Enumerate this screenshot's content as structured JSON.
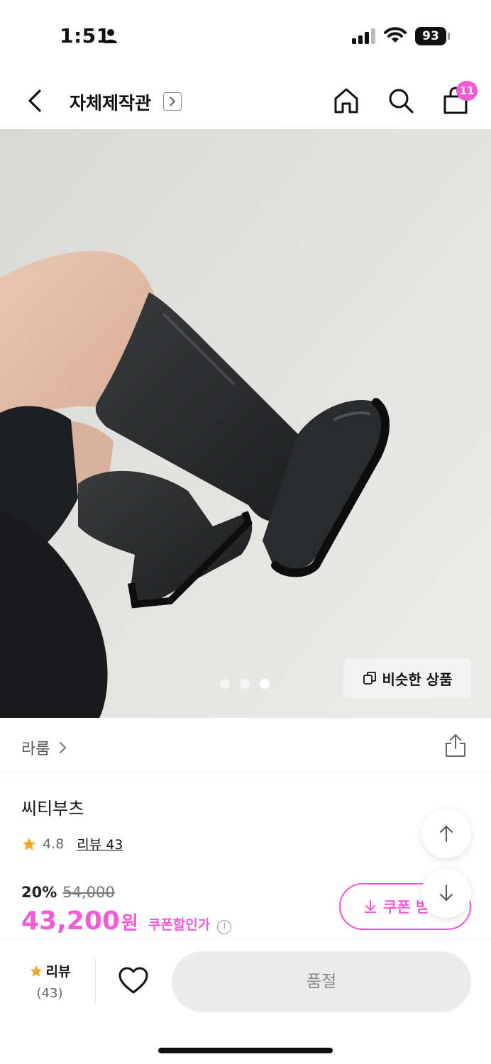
{
  "status_bar": {
    "time": "1:51",
    "battery": "93"
  },
  "header": {
    "title": "자체제작관",
    "cart_count": "11"
  },
  "hero": {
    "similar_button": "비슷한 상품",
    "slide_count": 3,
    "active_slide": 3
  },
  "brand": {
    "name": "라룸"
  },
  "product": {
    "name": "씨티부츠",
    "rating": "4.8",
    "review_label": "리뷰 43",
    "discount_percent": "20%",
    "original_price": "54,000",
    "price": "43,200",
    "currency": "원",
    "coupon_price_label": "쿠폰할인가",
    "coupon_button": "쿠폰 받"
  },
  "bottom_bar": {
    "review_label": "리뷰",
    "review_count": "(43)",
    "soldout_label": "품절"
  },
  "colors": {
    "accent": "#f25ad7",
    "star": "#f5a623"
  }
}
